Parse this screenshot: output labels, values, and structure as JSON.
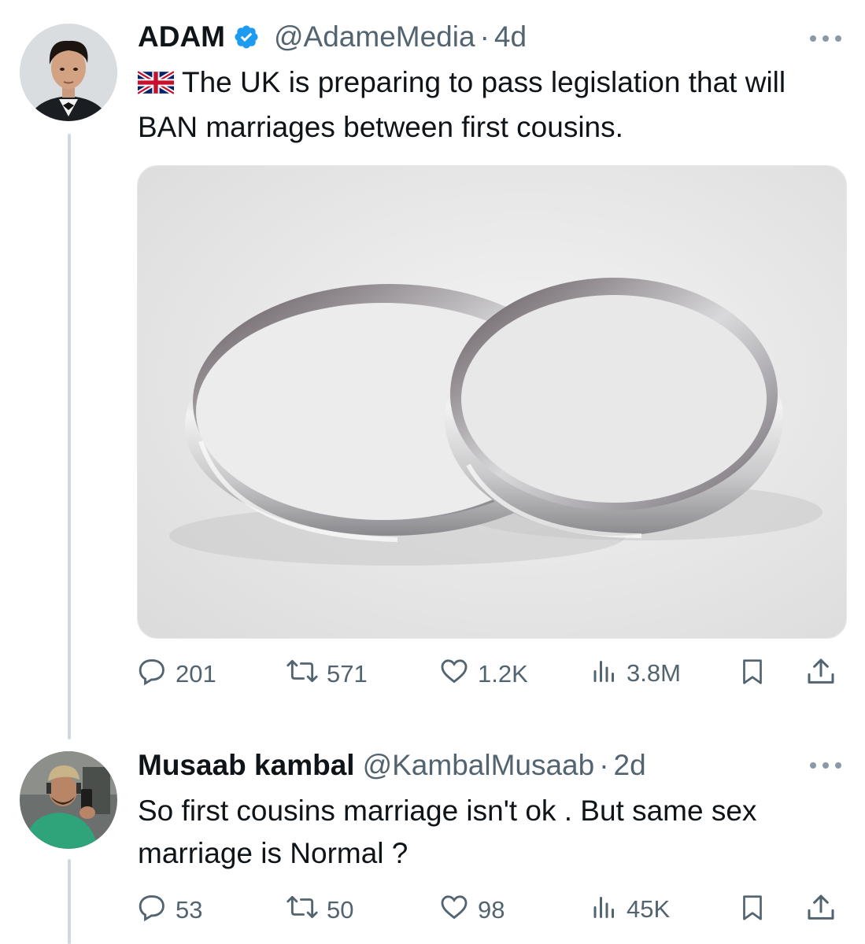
{
  "tweet": {
    "author_name": "ADAM",
    "handle": "@AdameMedia",
    "separator": "·",
    "time": "4d",
    "text": "The UK is preparing to pass legislation that will BAN marriages between first cousins.",
    "flag_icon": "uk-flag-icon",
    "verified_color": "#1d9bf0",
    "stats": {
      "replies": "201",
      "retweets": "571",
      "likes": "1.2K",
      "views": "3.8M"
    }
  },
  "reply": {
    "author_name": "Musaab kambal",
    "handle": "@KambalMusaab",
    "separator": "·",
    "time": "2d",
    "text": "So first cousins marriage isn't ok . But same sex marriage is Normal ?",
    "stats": {
      "replies": "53",
      "retweets": "50",
      "likes": "98",
      "views": "45K"
    }
  },
  "colors": {
    "text_primary": "#0f1419",
    "text_secondary": "#536471",
    "thread_line": "#cfd9de"
  }
}
